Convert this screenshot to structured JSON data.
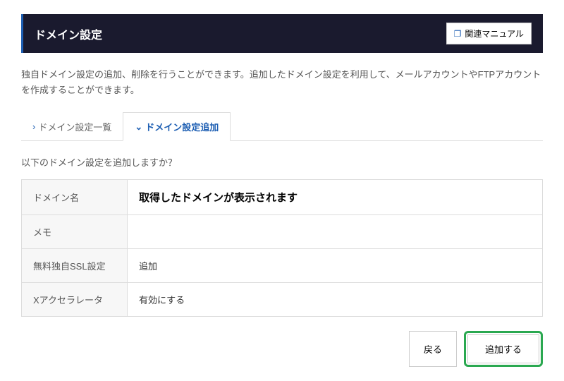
{
  "header": {
    "title": "ドメイン設定",
    "manual_label": "関連マニュアル"
  },
  "description": "独自ドメイン設定の追加、削除を行うことができます。追加したドメイン設定を利用して、メールアカウントやFTPアカウントを作成することができます。",
  "tabs": {
    "list": "ドメイン設定一覧",
    "add": "ドメイン設定追加"
  },
  "prompt": "以下のドメイン設定を追加しますか？",
  "rows": {
    "domain": {
      "label": "ドメイン名",
      "value": "取得したドメインが表示されます"
    },
    "memo": {
      "label": "メモ",
      "value": ""
    },
    "ssl": {
      "label": "無料独自SSL設定",
      "value": "追加"
    },
    "xaccel": {
      "label": "Xアクセラレータ",
      "value": "有効にする"
    }
  },
  "buttons": {
    "back": "戻る",
    "add": "追加する"
  }
}
